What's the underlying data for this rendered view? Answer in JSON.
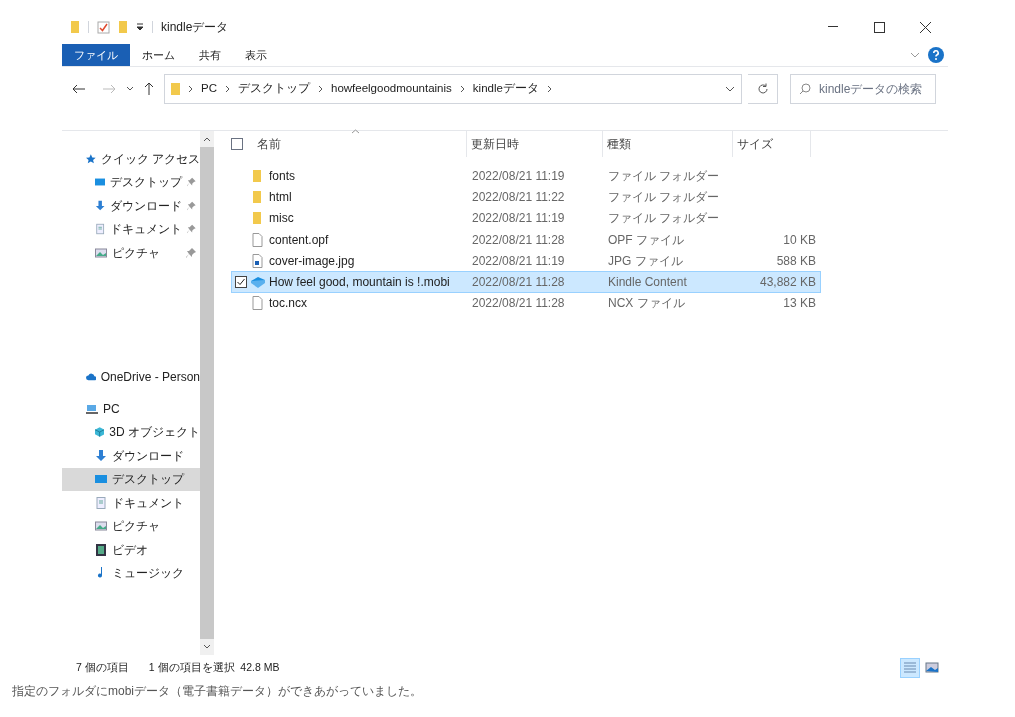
{
  "window": {
    "title": "kindleデータ"
  },
  "ribbon_tabs": [
    {
      "label": "ファイル",
      "selected": true
    },
    {
      "label": "ホーム",
      "selected": false
    },
    {
      "label": "共有",
      "selected": false
    },
    {
      "label": "表示",
      "selected": false
    }
  ],
  "address_bar": {
    "breadcrumbs": [
      "PC",
      "デスクトップ",
      "howfeelgoodmountainis",
      "kindleデータ"
    ]
  },
  "search": {
    "placeholder": "kindleデータの検索"
  },
  "nav_pane": [
    {
      "label": "クイック アクセス",
      "kind": "quick",
      "selected": false,
      "children": [
        {
          "label": "デスクトップ",
          "kind": "desktop",
          "pinned": true,
          "selected": false
        },
        {
          "label": "ダウンロード",
          "kind": "download",
          "pinned": true,
          "selected": false
        },
        {
          "label": "ドキュメント",
          "kind": "document",
          "pinned": true,
          "selected": false
        },
        {
          "label": "ピクチャ",
          "kind": "picture",
          "pinned": true,
          "selected": false
        }
      ]
    },
    {
      "label": "OneDrive - Person",
      "kind": "cloud",
      "selected": false
    },
    {
      "label": "PC",
      "kind": "pc",
      "selected": false,
      "children": [
        {
          "label": "3D オブジェクト",
          "kind": "cube",
          "pinned": false,
          "selected": false
        },
        {
          "label": "ダウンロード",
          "kind": "download",
          "pinned": false,
          "selected": false
        },
        {
          "label": "デスクトップ",
          "kind": "desktop",
          "pinned": false,
          "selected": true
        },
        {
          "label": "ドキュメント",
          "kind": "document",
          "pinned": false,
          "selected": false
        },
        {
          "label": "ピクチャ",
          "kind": "picture",
          "pinned": false,
          "selected": false
        },
        {
          "label": "ビデオ",
          "kind": "video",
          "pinned": false,
          "selected": false
        },
        {
          "label": "ミュージック",
          "kind": "music",
          "pinned": false,
          "selected": false
        }
      ]
    }
  ],
  "file_list": {
    "select_all_checked": false,
    "columns": [
      "名前",
      "更新日時",
      "種類",
      "サイズ"
    ],
    "rows": [
      {
        "kind": "folder",
        "name": "fonts",
        "modified": "2022/08/21 11:19",
        "type": "ファイル フォルダー",
        "selected": false
      },
      {
        "kind": "folder",
        "name": "html",
        "modified": "2022/08/21 11:22",
        "type": "ファイル フォルダー",
        "selected": false
      },
      {
        "kind": "folder",
        "name": "misc",
        "modified": "2022/08/21 11:19",
        "type": "ファイル フォルダー",
        "selected": false
      },
      {
        "kind": "file",
        "name": "content.opf",
        "modified": "2022/08/21 11:28",
        "type": "OPF ファイル",
        "size": "10 KB",
        "selected": false
      },
      {
        "kind": "image",
        "name": "cover-image.jpg",
        "modified": "2022/08/21 11:19",
        "type": "JPG ファイル",
        "size": "588 KB",
        "selected": false
      },
      {
        "kind": "kindle",
        "name": "How feel good, mountain is !.mobi",
        "modified": "2022/08/21 11:28",
        "type": "Kindle Content",
        "size": "43,882 KB",
        "selected": true
      },
      {
        "kind": "file",
        "name": "toc.ncx",
        "modified": "2022/08/21 11:28",
        "type": "NCX ファイル",
        "size": "13 KB",
        "selected": false
      }
    ]
  },
  "status_bar": {
    "item_count": "7 個の項目",
    "selection": "1 個の項目を選択  42.8 MB"
  },
  "view_buttons": [
    {
      "kind": "details",
      "selected": true
    },
    {
      "kind": "thumbnails",
      "selected": false
    }
  ],
  "caption": "指定のフォルダにmobiデータ（電子書籍データ）ができあがっていました。"
}
